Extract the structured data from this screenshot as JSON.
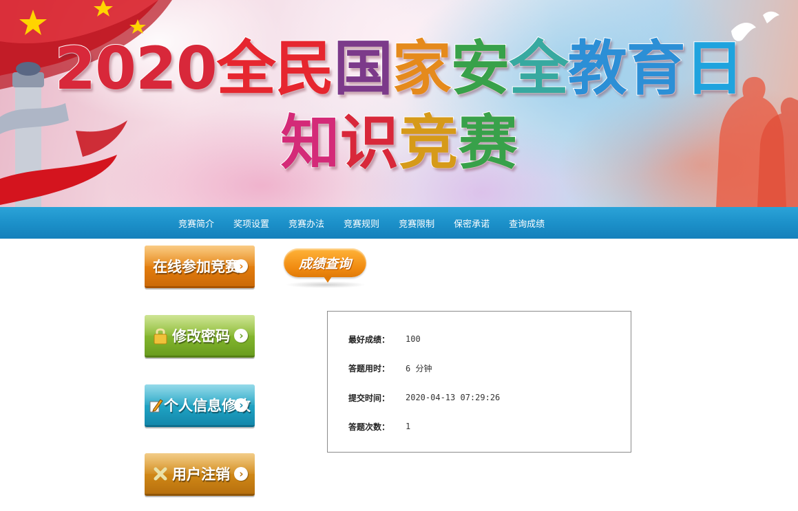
{
  "banner": {
    "title_line1_parts": [
      "2020",
      "全",
      "民",
      "国",
      "家",
      "安",
      "全",
      "教",
      "育",
      "日"
    ],
    "title_line2_parts": [
      "知",
      "识",
      "竞",
      "赛"
    ]
  },
  "nav": {
    "items": [
      "竞赛简介",
      "奖项设置",
      "竞赛办法",
      "竞赛规则",
      "竞赛限制",
      "保密承诺",
      "查询成绩"
    ]
  },
  "sidebar": {
    "buttons": [
      {
        "label": "在线参加竞赛",
        "icon": "chevron-right-icon",
        "color": "#e07a0c"
      },
      {
        "label": "修改密码",
        "icon": "padlock-icon",
        "color": "#7fb22b"
      },
      {
        "label": "个人信息修改",
        "icon": "pencil-icon",
        "color": "#1d9fc0"
      },
      {
        "label": "用户注销",
        "icon": "cross-icon",
        "color": "#cc8415"
      }
    ]
  },
  "section": {
    "badge": "成绩查询"
  },
  "result": {
    "best_score_label": "最好成绩：",
    "best_score": "100",
    "duration_label": "答题用时：",
    "duration": "6 分钟",
    "submit_time_label": "提交时间：",
    "submit_time": "2020-04-13 07:29:26",
    "attempts_label": "答题次数：",
    "attempts": "1"
  },
  "colors": {
    "nav_bg": "#1b8fc8",
    "accent_orange": "#f08a10"
  }
}
